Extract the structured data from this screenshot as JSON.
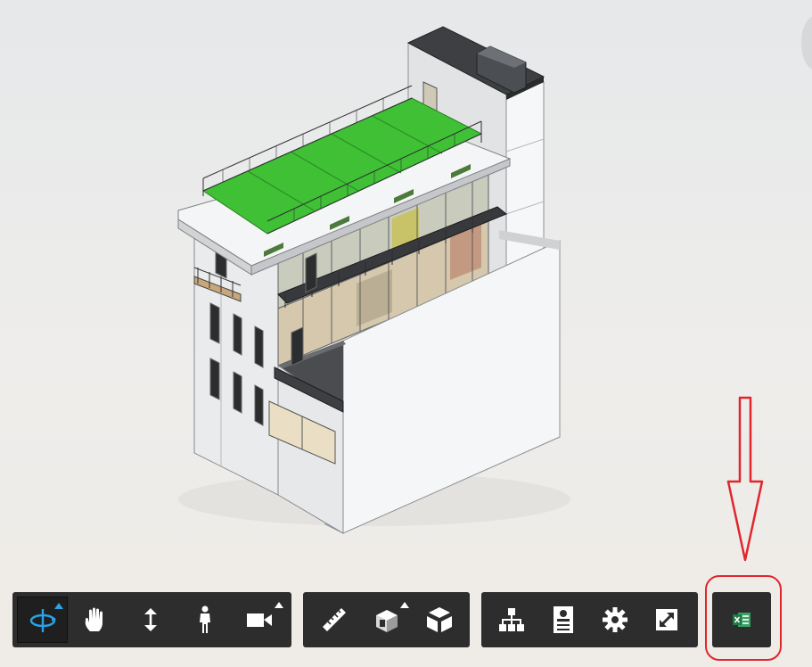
{
  "viewer": {
    "model_subject": "building-model",
    "accent_color": "#2aa3e6",
    "toolbar_background": "#2d2d2d",
    "annotation_color": "#e0262c",
    "roof_color": "#3fc035"
  },
  "toolbar": {
    "navigation": [
      {
        "id": "orbit",
        "icon": "orbit-icon",
        "active": true,
        "has_flyout": true
      },
      {
        "id": "pan",
        "icon": "pan-hand-icon",
        "active": false,
        "has_flyout": false
      },
      {
        "id": "zoom",
        "icon": "zoom-arrows-icon",
        "active": false,
        "has_flyout": false
      },
      {
        "id": "first-person",
        "icon": "person-icon",
        "active": false,
        "has_flyout": false
      },
      {
        "id": "camera",
        "icon": "camera-icon",
        "active": false,
        "has_flyout": true
      }
    ],
    "modeling": [
      {
        "id": "measure",
        "icon": "ruler-icon",
        "has_flyout": false
      },
      {
        "id": "section",
        "icon": "section-box-icon",
        "has_flyout": true
      },
      {
        "id": "explode",
        "icon": "explode-cube-icon",
        "has_flyout": false
      }
    ],
    "settings": [
      {
        "id": "model-browser",
        "icon": "hierarchy-icon"
      },
      {
        "id": "properties",
        "icon": "properties-panel-icon"
      },
      {
        "id": "settings",
        "icon": "gear-icon"
      },
      {
        "id": "fullscreen",
        "icon": "fullscreen-icon"
      }
    ],
    "extension": [
      {
        "id": "excel-export",
        "icon": "excel-icon",
        "color": "#1d7a45"
      }
    ]
  }
}
